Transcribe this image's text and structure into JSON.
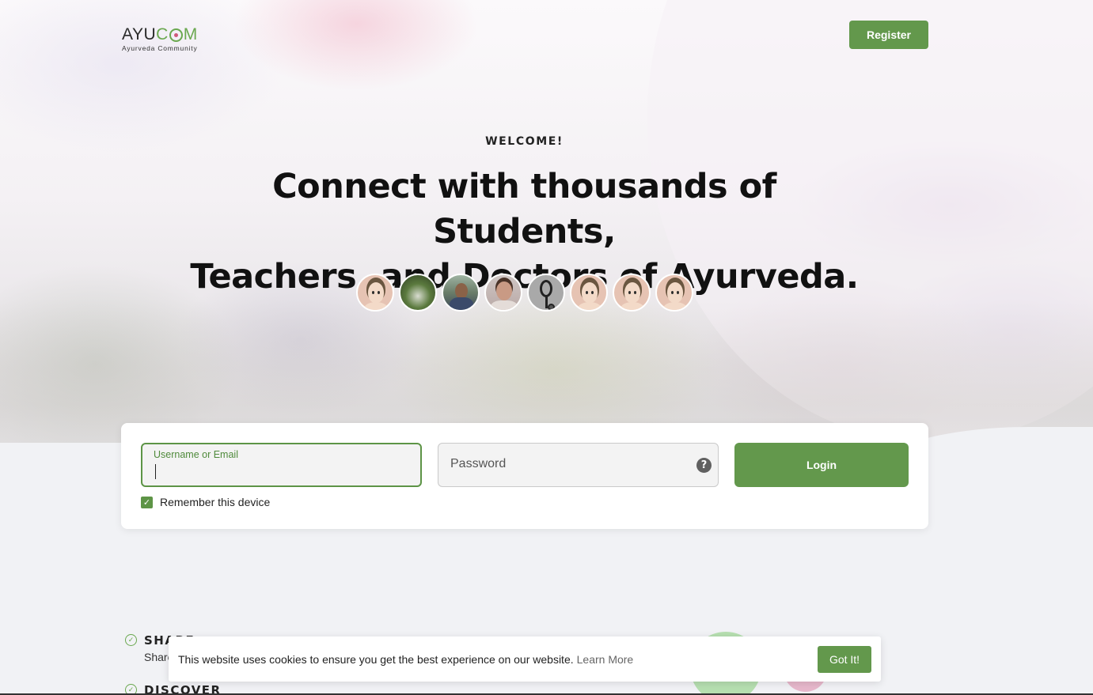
{
  "brand": {
    "logo_prefix": "AYU",
    "logo_c": "C",
    "logo_suffix": "M",
    "tagline": "Ayurveda Community",
    "accent_color": "#63984c"
  },
  "header": {
    "register_label": "Register"
  },
  "hero": {
    "welcome": "WELCOME!",
    "headline_line1": "Connect with thousands of Students,",
    "headline_line2": "Teachers, and Doctors of Ayurveda.",
    "avatars": [
      {
        "icon": "default-avatar-icon"
      },
      {
        "icon": "plant-photo-avatar"
      },
      {
        "icon": "man-outdoor-photo-avatar"
      },
      {
        "icon": "man-portrait-photo-avatar"
      },
      {
        "icon": "stethoscope-avatar-icon"
      },
      {
        "icon": "default-avatar-icon"
      },
      {
        "icon": "default-avatar-icon"
      },
      {
        "icon": "default-avatar-icon"
      }
    ]
  },
  "login": {
    "username_label": "Username or Email",
    "username_value": "",
    "password_placeholder": "Password",
    "help_symbol": "?",
    "login_label": "Login",
    "remember_label": "Remember this device",
    "remember_checked": true,
    "check_symbol": "✓"
  },
  "features": [
    {
      "title": "SHARE",
      "desc": "Share"
    },
    {
      "title": "DISCOVER",
      "desc": ""
    }
  ],
  "cookie": {
    "text": "This website uses cookies to ensure you get the best experience on our website.",
    "link": "Learn More",
    "button": "Got It!"
  }
}
